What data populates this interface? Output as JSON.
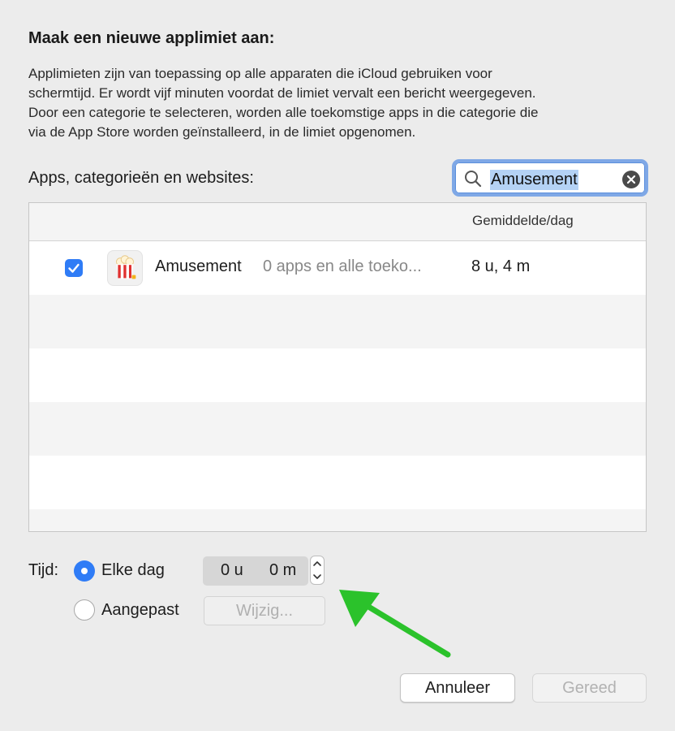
{
  "dialog": {
    "title": "Maak een nieuwe applimiet aan:",
    "description_lines": [
      "Applimieten zijn van toepassing op alle apparaten die iCloud gebruiken voor",
      "schermtijd. Er wordt vijf minuten voordat de limiet vervalt een bericht weergegeven.",
      "Door een categorie te selecteren, worden alle toekomstige apps in die categorie die",
      "via de App Store worden geïnstalleerd, in de limiet opgenomen."
    ]
  },
  "list": {
    "label": "Apps, categorieën en websites:",
    "search": {
      "value": "Amusement",
      "icon": "search-icon",
      "clear_icon": "clear-icon"
    },
    "column_avg": "Gemiddelde/dag",
    "rows": [
      {
        "checked": true,
        "icon": "popcorn-icon",
        "name": "Amusement",
        "subtitle": "0 apps en alle toeko...",
        "average": "8 u, 4 m"
      }
    ]
  },
  "time": {
    "label": "Tijd:",
    "option_daily": {
      "label": "Elke dag",
      "selected": true
    },
    "option_custom": {
      "label": "Aangepast",
      "selected": false
    },
    "hours": "0 u",
    "minutes": "0 m",
    "edit_button": "Wijzig..."
  },
  "buttons": {
    "cancel": "Annuleer",
    "done": "Gereed"
  },
  "colors": {
    "accent": "#2f7cf6",
    "annotation_arrow": "#2bc22b",
    "search_highlight": "#b4d2f5",
    "background": "#ececec"
  }
}
